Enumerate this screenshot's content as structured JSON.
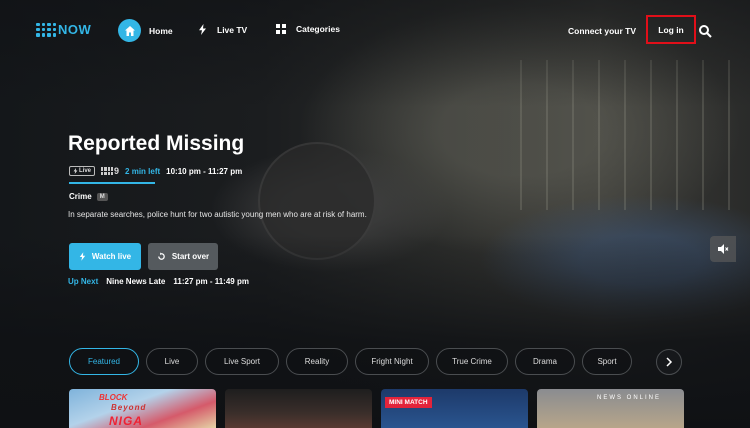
{
  "brand": {
    "logo_text": "NOW",
    "accent": "#33b6e6"
  },
  "nav": {
    "home_label": "Home",
    "live_tv_label": "Live TV",
    "categories_label": "Categories",
    "connect_label": "Connect your TV",
    "login_label": "Log in",
    "highlight_color": "#e10f19"
  },
  "hero": {
    "title": "Reported Missing",
    "live_badge": "Live",
    "channel": "9",
    "time_left": "2 min left",
    "time_range": "10:10 pm - 11:27 pm",
    "progress": 0.97,
    "genre": "Crime",
    "rating": "M",
    "description": "In separate searches, police hunt for two autistic young men who are at risk of harm.",
    "watch_live_label": "Watch live",
    "start_over_label": "Start over",
    "up_next_label": "Up Next",
    "up_next_title": "Nine News Late",
    "up_next_time": "11:27 pm - 11:49 pm"
  },
  "chips": [
    "Featured",
    "Live",
    "Live Sport",
    "Reality",
    "Fright Night",
    "True Crime",
    "Drama",
    "Sport"
  ],
  "cards": {
    "card1_top": "BLOCK",
    "card1_sub": "Beyond",
    "card1_big": "NIGA",
    "card3_tag": "MINI MATCH",
    "card4_text": "NEWS ONLINE"
  },
  "icons": [
    "home-icon",
    "bolt-icon",
    "grid-icon",
    "search-icon",
    "volume-icon",
    "chevron-right-icon",
    "restart-icon"
  ]
}
